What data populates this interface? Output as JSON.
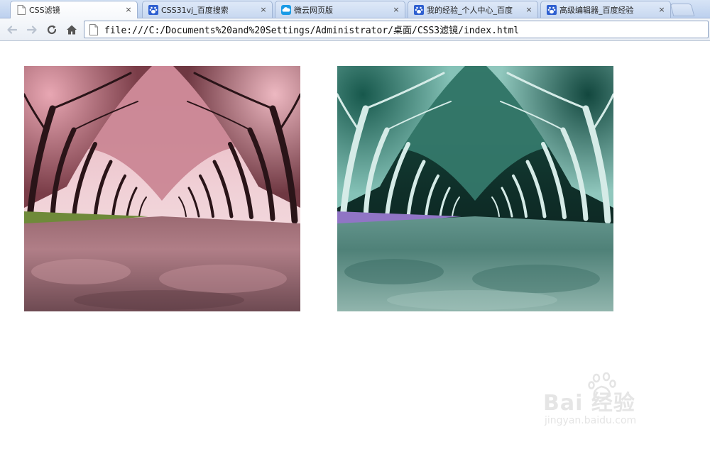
{
  "tabs": [
    {
      "label": "CSS滤镜",
      "icon": "page-icon",
      "active": true
    },
    {
      "label": "CSS31vj_百度搜索",
      "icon": "baidu-paw-icon",
      "active": false
    },
    {
      "label": "微云网页版",
      "icon": "weiyun-cloud-icon",
      "active": false
    },
    {
      "label": "我的经验_个人中心_百度",
      "icon": "baidu-paw-icon",
      "active": false
    },
    {
      "label": "高级编辑器_百度经验",
      "icon": "baidu-paw-icon",
      "active": false
    }
  ],
  "tab_close_glyph": "×",
  "toolbar": {
    "back": "back-arrow-icon",
    "forward": "forward-arrow-icon",
    "reload": "reload-icon",
    "home": "home-icon"
  },
  "address_bar": {
    "url": "file:///C:/Documents%20and%20Settings/Administrator/桌面/CSS3滤镜/index.html"
  },
  "page": {
    "images": [
      {
        "description": "cherry-blossom-avenue",
        "filter": "none"
      },
      {
        "description": "cherry-blossom-avenue",
        "filter": "invert"
      }
    ]
  },
  "watermark": {
    "brand": "Bai 经验",
    "site": "jingyan.baidu.com"
  }
}
